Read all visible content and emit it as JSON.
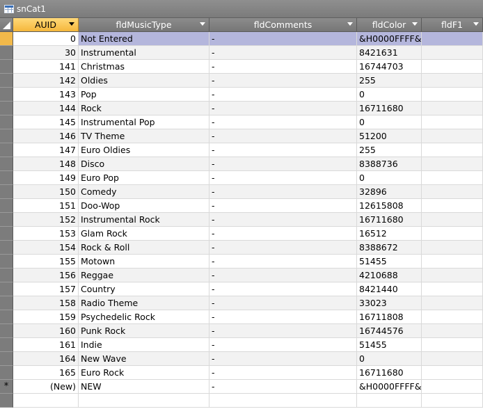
{
  "window": {
    "title": "snCat1"
  },
  "columns": [
    {
      "label": "AUID",
      "active": true
    },
    {
      "label": "fldMusicType",
      "active": false
    },
    {
      "label": "fldComments",
      "active": false
    },
    {
      "label": "fldColor",
      "active": false
    },
    {
      "label": "fldF1",
      "active": false
    }
  ],
  "rows": [
    {
      "auid": "0",
      "type": "Not Entered",
      "comments": "-",
      "color": "&H0000FFFF&"
    },
    {
      "auid": "30",
      "type": "Instrumental",
      "comments": "-",
      "color": "8421631"
    },
    {
      "auid": "141",
      "type": "Christmas",
      "comments": "-",
      "color": "16744703"
    },
    {
      "auid": "142",
      "type": "Oldies",
      "comments": "-",
      "color": "255"
    },
    {
      "auid": "143",
      "type": "Pop",
      "comments": "-",
      "color": "0"
    },
    {
      "auid": "144",
      "type": "Rock",
      "comments": "-",
      "color": "16711680"
    },
    {
      "auid": "145",
      "type": "Instrumental Pop",
      "comments": "-",
      "color": "0"
    },
    {
      "auid": "146",
      "type": "TV Theme",
      "comments": "-",
      "color": "51200"
    },
    {
      "auid": "147",
      "type": "Euro Oldies",
      "comments": "-",
      "color": "255"
    },
    {
      "auid": "148",
      "type": "Disco",
      "comments": "-",
      "color": "8388736"
    },
    {
      "auid": "149",
      "type": "Euro Pop",
      "comments": "-",
      "color": "0"
    },
    {
      "auid": "150",
      "type": "Comedy",
      "comments": "-",
      "color": "32896"
    },
    {
      "auid": "151",
      "type": "Doo-Wop",
      "comments": "-",
      "color": "12615808"
    },
    {
      "auid": "152",
      "type": "Instrumental Rock",
      "comments": "-",
      "color": "16711680"
    },
    {
      "auid": "153",
      "type": "Glam Rock",
      "comments": "-",
      "color": "16512"
    },
    {
      "auid": "154",
      "type": "Rock & Roll",
      "comments": "-",
      "color": "8388672"
    },
    {
      "auid": "155",
      "type": "Motown",
      "comments": "-",
      "color": "51455"
    },
    {
      "auid": "156",
      "type": "Reggae",
      "comments": "-",
      "color": "4210688"
    },
    {
      "auid": "157",
      "type": "Country",
      "comments": "-",
      "color": "8421440"
    },
    {
      "auid": "158",
      "type": "Radio Theme",
      "comments": "-",
      "color": "33023"
    },
    {
      "auid": "159",
      "type": "Psychedelic Rock",
      "comments": "-",
      "color": "16711808"
    },
    {
      "auid": "160",
      "type": "Punk Rock",
      "comments": "-",
      "color": "16744576"
    },
    {
      "auid": "161",
      "type": "Indie",
      "comments": "-",
      "color": "51455"
    },
    {
      "auid": "164",
      "type": "New Wave",
      "comments": "-",
      "color": "0"
    },
    {
      "auid": "165",
      "type": "Euro Rock",
      "comments": "-",
      "color": "16711680"
    }
  ],
  "new_row": {
    "marker": "*",
    "auid": "(New)",
    "type": "NEW",
    "comments": "-",
    "color": "&H0000FFFF&"
  },
  "colors": {
    "header_bg": "#7f7f7f",
    "active_header": "#f5b73b",
    "current_row": "#b4b6dc",
    "alt_row": "#f2f2f2"
  }
}
